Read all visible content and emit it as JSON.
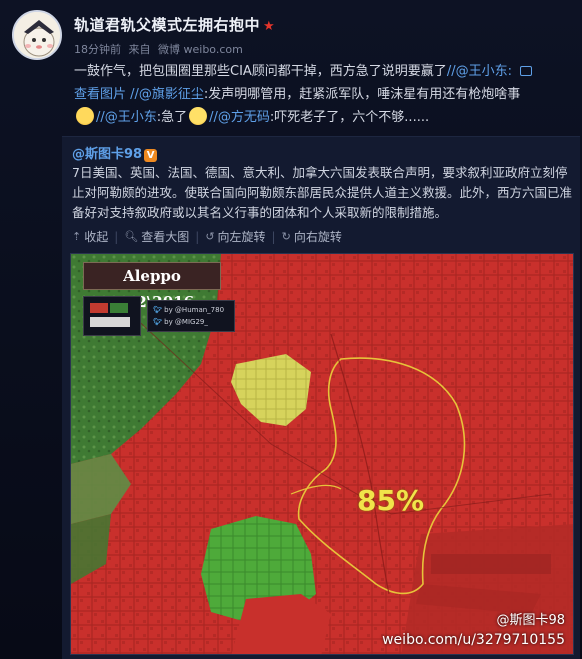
{
  "post": {
    "username": "轨道君轨父模式左拥右抱中",
    "star": "★",
    "meta": {
      "time": "18分钟前",
      "source_label": "来自",
      "source": "微博 weibo.com"
    },
    "text_part1": "一鼓作气，把包围圈里那些CIA顾问都干掉，西方急了说明要赢了",
    "mention1": "//@王小东:",
    "view_image": "查看图片",
    "mention2": "//@旗影征尘",
    "text_part2": ":发声明哪管用，赶紧派军队，唾沫星有用还有枪炮啥事",
    "mention3": "//@王小东",
    "text_part3": ":急了",
    "mention4": "//@方无码",
    "text_part4": ":吓死老子了，六个不够......"
  },
  "repost": {
    "author": "@斯图卡98",
    "verified_badge": "V",
    "text": "7日美国、英国、法国、德国、意大利、加拿大六国发表联合声明，要求叙利亚政府立刻停止对阿勒颇的进攻。使联合国向阿勒颇东部居民众提供人道主义救援。此外，西方六国已准备好对支持叙政府或以其名义行事的团体和个人采取新的限制措施。",
    "actions": {
      "collapse": "收起",
      "view_large": "查看大图",
      "rotate_left": "向左旋转",
      "rotate_right": "向右旋转"
    }
  },
  "map": {
    "title": "Aleppo 7\\12\\2016",
    "credit_line1": "by @Human_780",
    "credit_line2": "by @MIG29_",
    "percentage": "85%",
    "watermark": "@斯图卡98",
    "watermark_url": "weibo.com/u/3279710155"
  },
  "colors": {
    "link": "#5fa0e8",
    "gov_red": "#c8302c",
    "rebel_green": "#4fae3a",
    "kurd_yellow": "#d9d75a",
    "front_line": "#e7c23a"
  }
}
